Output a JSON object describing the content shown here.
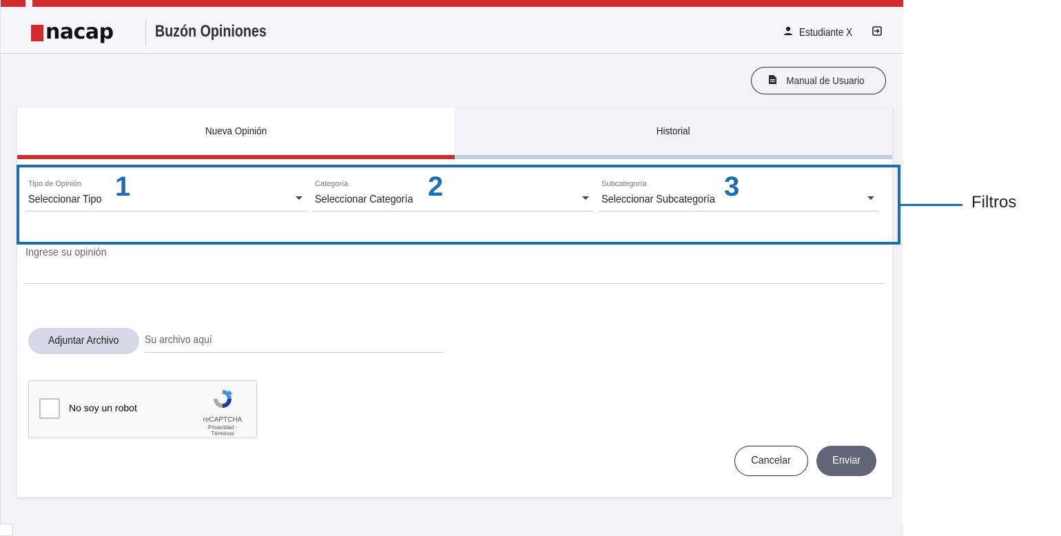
{
  "header": {
    "logo_text": "nacap",
    "title": "Buzón Opiniones",
    "user_name": "Estudiante X"
  },
  "manual_button": {
    "label": "Manual de Usuario"
  },
  "tabs": [
    {
      "label": "Nueva Opinión",
      "active": true
    },
    {
      "label": "Historial",
      "active": false
    }
  ],
  "filters": [
    {
      "label": "Tipo de Opinión",
      "value": "Seleccionar Tipo",
      "annotation": "1"
    },
    {
      "label": "Categoría",
      "value": "Seleccionar Categoría",
      "annotation": "2"
    },
    {
      "label": "Subcategoría",
      "value": "Seleccionar Subcategoría",
      "annotation": "3"
    }
  ],
  "filters_annotation_label": "Filtros",
  "opinion": {
    "placeholder": "Ingrese su opinión"
  },
  "attachment": {
    "button_label": "Adjuntar Archivo",
    "placeholder": "Su archivo aquí"
  },
  "recaptcha": {
    "label": "No soy un robot",
    "brand": "reCAPTCHA",
    "links": "Privacidad - Términos"
  },
  "actions": {
    "cancel_label": "Cancelar",
    "send_label": "Enviar"
  },
  "colors": {
    "brand_red": "#d12b2d",
    "annotation_blue": "#1e6db4",
    "send_button": "#626478",
    "inactive_tab_underline": "#c8ccdf"
  }
}
